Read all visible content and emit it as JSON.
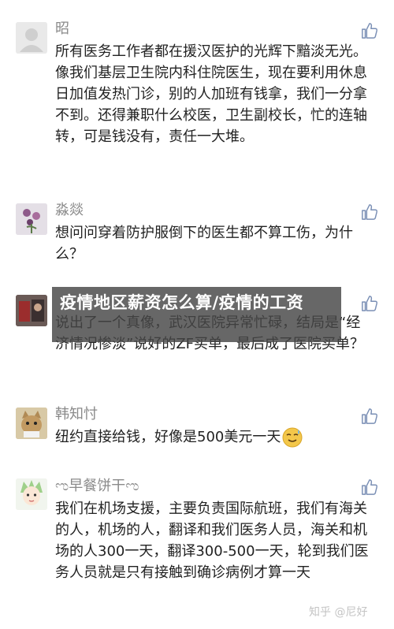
{
  "comments": [
    {
      "name": "昭",
      "text": "所有医务工作者都在援汉医护的光辉下黯淡无光。像我们基层卫生院内科住院医生，现在要利用休息日加值发热门诊，别的人加班有钱拿，我们一分拿不到。还得兼职什么校医，卫生副校长，忙的连轴转，可是钱没有，责任一大堆。"
    },
    {
      "name": "淼燚",
      "text": "想问问穿着防护服倒下的医生都不算工伤，为什么？"
    },
    {
      "name": "",
      "text": "说出了一个真像，武汉医院异常忙碌，结局是“经济情况惨淡”说好的ZF买单，最后成了医院买单？"
    },
    {
      "name": "韩知忖",
      "text": "纽约直接给钱，好像是500美元一天"
    },
    {
      "name": "早餐饼干",
      "name_decor_left": "ಌ",
      "name_decor_right": "ಌ",
      "text": "我们在机场支援，主要负责国际航班，我们有海关的人，机场的人，翻译和我们医务人员，海关和机场的人300一天，翻译300-500一天，轮到我们医务人员就是只有接触到确诊病例才算一天"
    }
  ],
  "banner": {
    "title": "疫情地区薪资怎么算/疫情的工资"
  },
  "watermark": "知乎 @尼好",
  "icons": {
    "like": "thumbs-up-icon",
    "emoji": "sweat-smile-emoji-icon"
  },
  "colors": {
    "name": "#8a8a8a",
    "text": "#222222",
    "icon": "#7a8fb5"
  }
}
